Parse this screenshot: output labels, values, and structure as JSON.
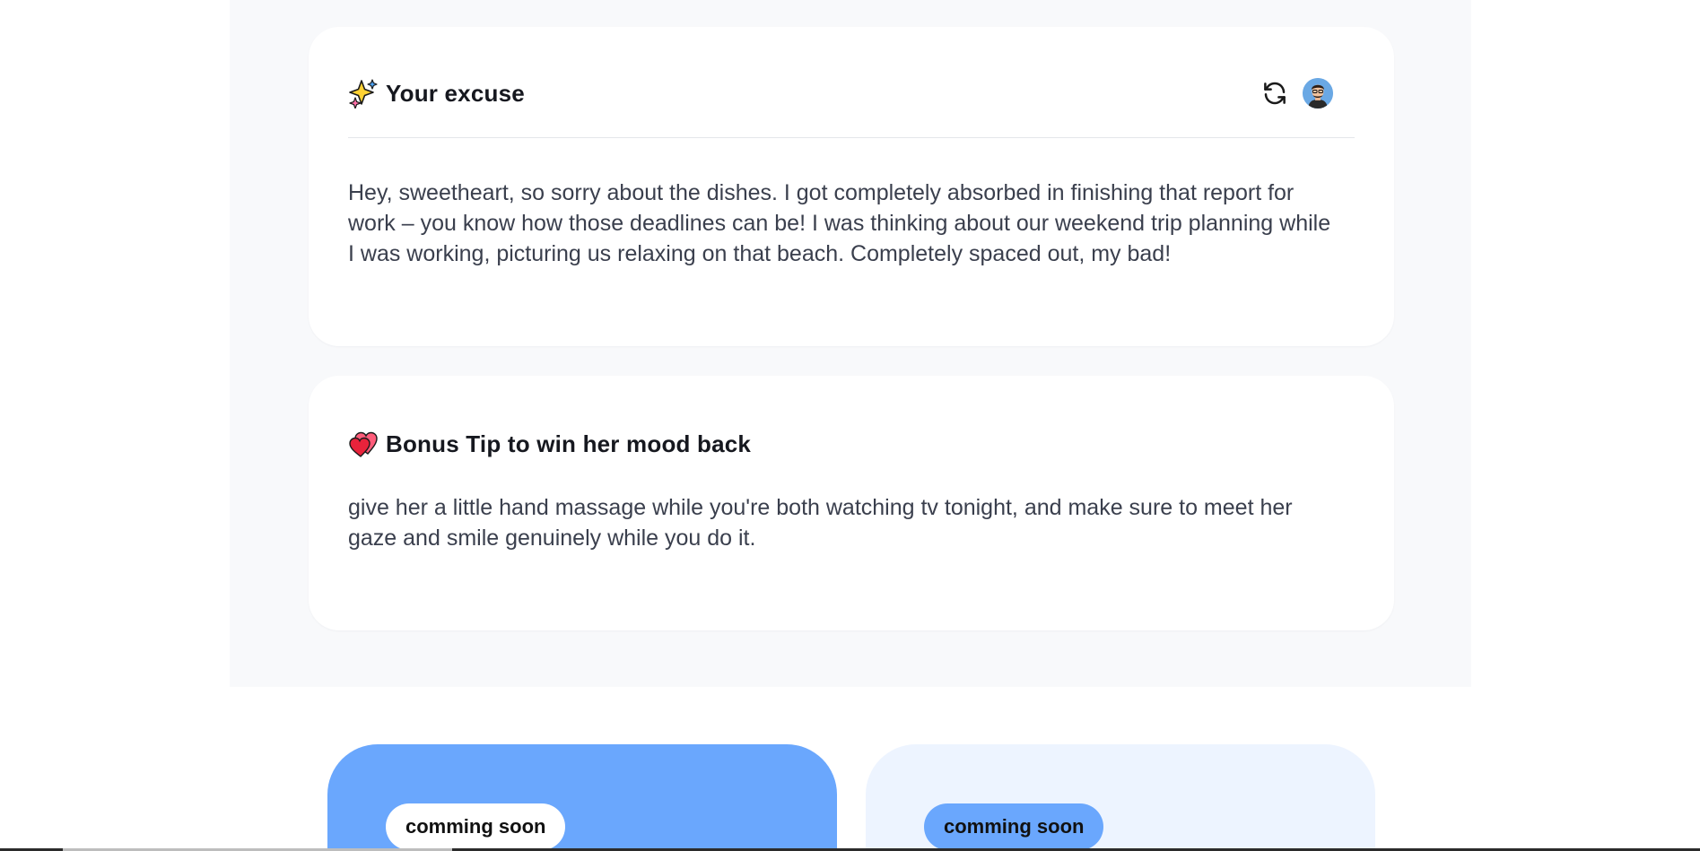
{
  "excuse_card": {
    "title": "Your excuse",
    "header_icon": "sparkles-icon",
    "actions": [
      "refresh-icon",
      "avatar"
    ],
    "text": "Hey, sweetheart, so sorry about the dishes. I got completely absorbed in finishing that report for work – you know how those deadlines can be! I was thinking about our weekend trip planning while I was working, picturing us relaxing on that beach. Completely spaced out, my bad!"
  },
  "tip_card": {
    "title": "Bonus Tip to win her mood back",
    "header_icon": "two-hearts-icon",
    "text": "give her a little hand massage while you're both watching tv tonight, and make sure to meet her gaze and smile genuinely while you do it."
  },
  "promos": [
    {
      "badge": "comming soon"
    },
    {
      "badge": "comming soon"
    }
  ],
  "colors": {
    "accent_blue": "#6aa7fd",
    "light_blue": "#edf4ff",
    "stage_bg": "#f8f9fb"
  }
}
